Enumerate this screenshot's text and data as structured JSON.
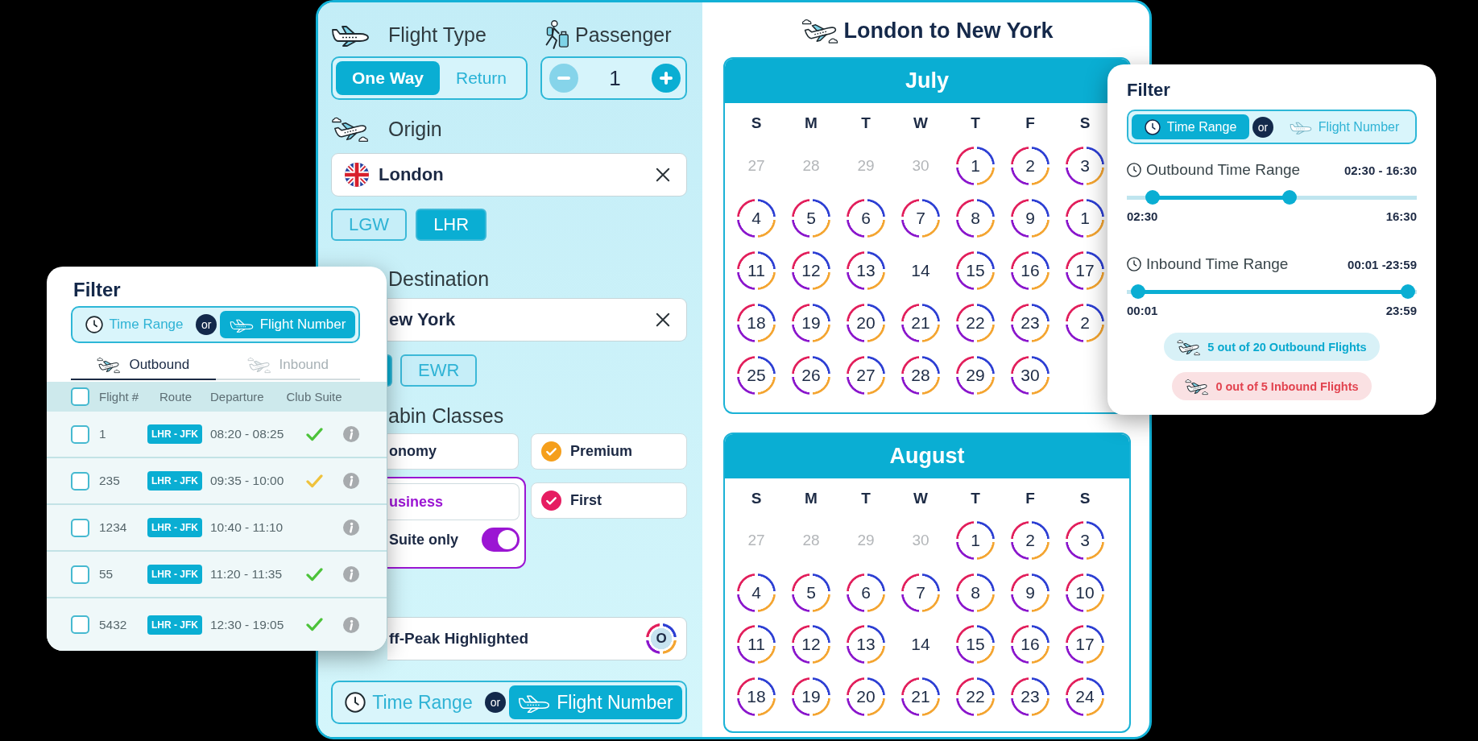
{
  "search_form": {
    "flight_type": {
      "label": "Flight Type",
      "options": [
        {
          "label": "One Way",
          "selected": true
        },
        {
          "label": "Return",
          "selected": false
        }
      ]
    },
    "passenger": {
      "label": "Passenger",
      "count": "1",
      "decrease_disabled": true
    },
    "origin": {
      "label": "Origin",
      "value": "London",
      "airports": [
        {
          "label": "LGW",
          "selected": false
        },
        {
          "label": "LHR",
          "selected": true
        }
      ]
    },
    "destination": {
      "label": "Destination",
      "value": "ew York",
      "airports": [
        {
          "selected": true
        },
        {
          "label": "EWR",
          "selected": false
        }
      ]
    },
    "cabin_classes": {
      "label": "abin Classes",
      "items": [
        {
          "label": "onomy",
          "checked": false
        },
        {
          "label": "Premium",
          "checked": true,
          "color": "#f59f1c"
        },
        {
          "label": "usiness",
          "checked": false,
          "color": "#9b16d3",
          "suite_only": {
            "label": "Suite only",
            "on": true
          }
        },
        {
          "label": "First",
          "checked": true,
          "color": "#e61d61"
        }
      ]
    },
    "off_peak": {
      "label": "ff-Peak Highlighted",
      "marker": "O"
    },
    "search_mode": {
      "separator": "or",
      "options": [
        {
          "kind": "time",
          "label": "Time Range",
          "selected": false
        },
        {
          "kind": "flight",
          "label": "Flight Number",
          "selected": true
        }
      ]
    }
  },
  "calendar": {
    "title": "London to New York",
    "months": [
      {
        "name": "July",
        "weekdays": [
          "S",
          "M",
          "T",
          "W",
          "T",
          "F",
          "S"
        ],
        "days": [
          {
            "label": "27",
            "kind": "outside"
          },
          {
            "label": "28",
            "kind": "outside"
          },
          {
            "label": "29",
            "kind": "outside"
          },
          {
            "label": "30",
            "kind": "outside"
          },
          {
            "label": "1",
            "kind": "ringed"
          },
          {
            "label": "2",
            "kind": "ringed"
          },
          {
            "label": "3",
            "kind": "ringed"
          },
          {
            "label": "4",
            "kind": "ringed"
          },
          {
            "label": "5",
            "kind": "ringed"
          },
          {
            "label": "6",
            "kind": "ringed"
          },
          {
            "label": "7",
            "kind": "ringed"
          },
          {
            "label": "8",
            "kind": "ringed"
          },
          {
            "label": "9",
            "kind": "ringed"
          },
          {
            "label": "1",
            "kind": "ringed"
          },
          {
            "label": "11",
            "kind": "ringed"
          },
          {
            "label": "12",
            "kind": "ringed"
          },
          {
            "label": "13",
            "kind": "ringed"
          },
          {
            "label": "14",
            "kind": "plain"
          },
          {
            "label": "15",
            "kind": "ringed"
          },
          {
            "label": "16",
            "kind": "ringed"
          },
          {
            "label": "17",
            "kind": "ringed"
          },
          {
            "label": "18",
            "kind": "ringed"
          },
          {
            "label": "19",
            "kind": "ringed"
          },
          {
            "label": "20",
            "kind": "ringed"
          },
          {
            "label": "21",
            "kind": "ringed"
          },
          {
            "label": "22",
            "kind": "ringed"
          },
          {
            "label": "23",
            "kind": "ringed"
          },
          {
            "label": "2",
            "kind": "ringed"
          },
          {
            "label": "25",
            "kind": "ringed"
          },
          {
            "label": "26",
            "kind": "ringed"
          },
          {
            "label": "27",
            "kind": "ringed"
          },
          {
            "label": "28",
            "kind": "ringed"
          },
          {
            "label": "29",
            "kind": "ringed"
          },
          {
            "label": "30",
            "kind": "ringed"
          }
        ]
      },
      {
        "name": "August",
        "weekdays": [
          "S",
          "M",
          "T",
          "W",
          "T",
          "F",
          "S"
        ],
        "days": [
          {
            "label": "27",
            "kind": "outside"
          },
          {
            "label": "28",
            "kind": "outside"
          },
          {
            "label": "29",
            "kind": "outside"
          },
          {
            "label": "30",
            "kind": "outside"
          },
          {
            "label": "1",
            "kind": "ringed"
          },
          {
            "label": "2",
            "kind": "ringed"
          },
          {
            "label": "3",
            "kind": "ringed"
          },
          {
            "label": "4",
            "kind": "ringed"
          },
          {
            "label": "5",
            "kind": "ringed"
          },
          {
            "label": "6",
            "kind": "ringed"
          },
          {
            "label": "7",
            "kind": "ringed"
          },
          {
            "label": "8",
            "kind": "ringed"
          },
          {
            "label": "9",
            "kind": "ringed"
          },
          {
            "label": "10",
            "kind": "ringed"
          },
          {
            "label": "11",
            "kind": "ringed"
          },
          {
            "label": "12",
            "kind": "ringed"
          },
          {
            "label": "13",
            "kind": "ringed"
          },
          {
            "label": "14",
            "kind": "plain"
          },
          {
            "label": "15",
            "kind": "ringed"
          },
          {
            "label": "16",
            "kind": "ringed"
          },
          {
            "label": "17",
            "kind": "ringed"
          },
          {
            "label": "18",
            "kind": "ringed"
          },
          {
            "label": "19",
            "kind": "ringed"
          },
          {
            "label": "20",
            "kind": "ringed"
          },
          {
            "label": "21",
            "kind": "ringed"
          },
          {
            "label": "22",
            "kind": "ringed"
          },
          {
            "label": "23",
            "kind": "ringed"
          },
          {
            "label": "24",
            "kind": "ringed"
          }
        ]
      }
    ]
  },
  "flight_filter": {
    "title": "Filter",
    "mode": {
      "separator": "or",
      "options": [
        {
          "kind": "time",
          "label": "Time Range",
          "selected": false
        },
        {
          "kind": "flight",
          "label": "Flight Number",
          "selected": true
        }
      ]
    },
    "tabs": [
      {
        "label": "Outbound",
        "selected": true
      },
      {
        "label": "Inbound",
        "selected": false
      }
    ],
    "table": {
      "select_all": {
        "checked": false
      },
      "columns": [
        "Flight #",
        "Route",
        "Departure",
        "Club Suite"
      ],
      "rows": [
        {
          "checked": false,
          "flight": "1",
          "route": "LHR - JFK",
          "departure": "08:20 - 08:25",
          "club_suite": true,
          "color": "#4cc33a"
        },
        {
          "checked": false,
          "flight": "235",
          "route": "LHR - JFK",
          "departure": "09:35 - 10:00",
          "club_suite": true,
          "color": "#efc23c"
        },
        {
          "checked": false,
          "flight": "1234",
          "route": "LHR - JFK",
          "departure": "10:40 - 11:10",
          "club_suite": false
        },
        {
          "checked": false,
          "flight": "55",
          "route": "LHR - JFK",
          "departure": "11:20 - 11:35",
          "club_suite": true,
          "color": "#4cc33a"
        },
        {
          "checked": false,
          "flight": "5432",
          "route": "LHR - JFK",
          "departure": "12:30 - 19:05",
          "club_suite": true,
          "color": "#4cc33a"
        }
      ]
    }
  },
  "time_filter": {
    "title": "Filter",
    "mode": {
      "separator": "or",
      "options": [
        {
          "kind": "time",
          "label": "Time Range",
          "selected": true
        },
        {
          "kind": "flight",
          "label": "Flight Number",
          "selected": false
        }
      ]
    },
    "ranges": [
      {
        "label": "Outbound Time Range",
        "reading": "02:30 - 16:30",
        "thumbs": [
          {
            "level": 0.09
          },
          {
            "level": 0.56
          }
        ],
        "low_label": "02:30",
        "high_label": "16:30"
      },
      {
        "label": "Inbound Time Range",
        "reading": "00:01 -23:59",
        "thumbs": [
          {
            "level": 0.04
          },
          {
            "level": 0.97
          }
        ],
        "low_label": "00:01",
        "high_label": "23:59"
      }
    ],
    "counts": [
      {
        "text": "5 out of 20 Outbound Flights",
        "color": "#0aa9cf"
      },
      {
        "text": "0 out of 5 Inbound Flights",
        "color": "#e2434f"
      }
    ]
  }
}
